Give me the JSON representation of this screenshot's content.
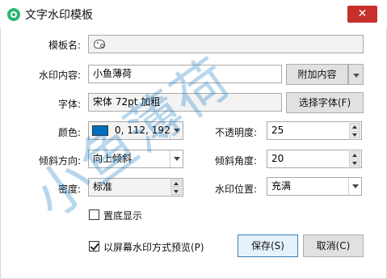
{
  "window": {
    "title": "文字水印模板",
    "close_glyph": "✕"
  },
  "form": {
    "template_name": {
      "label": "模板名:",
      "value": ""
    },
    "watermark_content": {
      "label": "水印内容:",
      "value": "小鱼薄荷"
    },
    "add_content_button": "附加内容",
    "font": {
      "label": "字体:",
      "value": "宋体 72pt 加粗"
    },
    "choose_font_button": "选择字体(F)",
    "color": {
      "label": "颜色:",
      "value": "0, 112, 192",
      "swatch_color": "#0070c0"
    },
    "opacity": {
      "label": "不透明度:",
      "value": "25"
    },
    "tilt_direction": {
      "label": "倾斜方向:",
      "value": "向上倾斜"
    },
    "tilt_angle": {
      "label": "倾斜角度:",
      "value": "20"
    },
    "density": {
      "label": "密度:",
      "value": "标准"
    },
    "position": {
      "label": "水印位置:",
      "value": "充满"
    },
    "bottom_display": {
      "label": "置底显示",
      "checked": false
    },
    "screen_preview": {
      "label": "以屏幕水印方式预览(P)",
      "checked": true
    }
  },
  "buttons": {
    "save": "保存(S)",
    "cancel": "取消(C)"
  },
  "watermark_preview": {
    "text": "小鱼薄荷",
    "color": "#0070c0"
  }
}
